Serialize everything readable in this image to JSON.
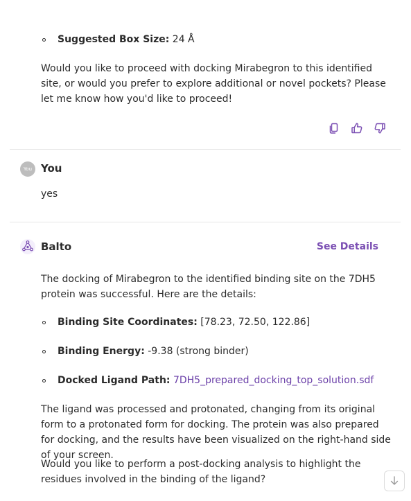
{
  "message1": {
    "bullet_box": {
      "label": "Suggested Box Size:",
      "value": "24 Å"
    },
    "paragraph": "Would you like to proceed with docking Mirabegron to this identified site, or would you prefer to explore additional or novel pockets? Please let me know how you'd like to proceed!",
    "actions": [
      "copy-icon",
      "thumbs-up-icon",
      "thumbs-down-icon"
    ]
  },
  "user_message": {
    "avatar_text": "You",
    "author": "You",
    "text": "yes"
  },
  "assistant_message": {
    "author": "Balto",
    "see_details_label": "See Details",
    "intro": "The docking of Mirabegron to the identified binding site on the 7DH5 protein was successful. Here are the details:",
    "bullets": [
      {
        "label": "Binding Site Coordinates:",
        "value": "[78.23, 72.50, 122.86]"
      },
      {
        "label": "Binding Energy:",
        "value": "-9.38 (strong binder)"
      },
      {
        "label": "Docked Ligand Path:",
        "value": "7DH5_prepared_docking_top_solution.sdf"
      }
    ],
    "paragraph2": "The ligand was processed and protonated, changing from its original form to a protonated form for docking. The protein was also prepared for docking, and the results have been visualized on the right-hand side of your screen.",
    "paragraph3": "Would you like to perform a post-docking analysis to highlight the residues involved in the binding of the ligand?"
  },
  "colors": {
    "accent": "#7b4fb3",
    "link": "#6a3fa8",
    "divider": "#e6e6e6",
    "avatar_user": "#bdbdbd"
  },
  "scroll_button_icon": "arrow-down-icon"
}
